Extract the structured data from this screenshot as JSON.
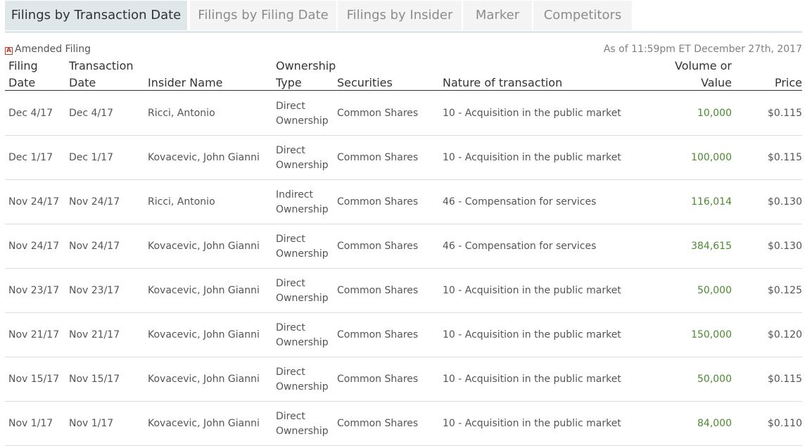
{
  "tabs": [
    {
      "label": "Filings by Transaction Date",
      "active": true
    },
    {
      "label": "Filings by Filing Date",
      "active": false
    },
    {
      "label": "Filings by Insider",
      "active": false
    },
    {
      "label": "Marker",
      "active": false
    },
    {
      "label": "Competitors",
      "active": false
    }
  ],
  "legend": {
    "icon": "amended-filing-icon",
    "icon_glyph": "A",
    "label": "Amended Filing"
  },
  "as_of": "As of 11:59pm ET December 27th, 2017",
  "colors": {
    "volume": "#4b8b2f",
    "active_tab": "#dfe7ea",
    "inactive_tab": "#f4f4f4",
    "amended": "#c0392b"
  },
  "table": {
    "headers": {
      "filing_date": [
        "Filing",
        "Date"
      ],
      "transaction_date": [
        "Transaction",
        "Date"
      ],
      "insider_name": "Insider Name",
      "ownership_type": [
        "Ownership",
        "Type"
      ],
      "securities": "Securities",
      "nature": "Nature of transaction",
      "volume": [
        "Volume or",
        "Value"
      ],
      "price": "Price"
    },
    "rows": [
      {
        "filing_date": "Dec 4/17",
        "transaction_date": "Dec 4/17",
        "insider": "Ricci, Antonio",
        "ownership": [
          "Direct",
          "Ownership"
        ],
        "securities": "Common Shares",
        "nature": "10 - Acquisition in the public market",
        "volume": "10,000",
        "price": "$0.115"
      },
      {
        "filing_date": "Dec 1/17",
        "transaction_date": "Dec 1/17",
        "insider": "Kovacevic, John Gianni",
        "ownership": [
          "Direct",
          "Ownership"
        ],
        "securities": "Common Shares",
        "nature": "10 - Acquisition in the public market",
        "volume": "100,000",
        "price": "$0.115"
      },
      {
        "filing_date": "Nov 24/17",
        "transaction_date": "Nov 24/17",
        "insider": "Ricci, Antonio",
        "ownership": [
          "Indirect",
          "Ownership"
        ],
        "securities": "Common Shares",
        "nature": "46 - Compensation for services",
        "volume": "116,014",
        "price": "$0.130"
      },
      {
        "filing_date": "Nov 24/17",
        "transaction_date": "Nov 24/17",
        "insider": "Kovacevic, John Gianni",
        "ownership": [
          "Direct",
          "Ownership"
        ],
        "securities": "Common Shares",
        "nature": "46 - Compensation for services",
        "volume": "384,615",
        "price": "$0.130"
      },
      {
        "filing_date": "Nov 23/17",
        "transaction_date": "Nov 23/17",
        "insider": "Kovacevic, John Gianni",
        "ownership": [
          "Direct",
          "Ownership"
        ],
        "securities": "Common Shares",
        "nature": "10 - Acquisition in the public market",
        "volume": "50,000",
        "price": "$0.125"
      },
      {
        "filing_date": "Nov 21/17",
        "transaction_date": "Nov 21/17",
        "insider": "Kovacevic, John Gianni",
        "ownership": [
          "Direct",
          "Ownership"
        ],
        "securities": "Common Shares",
        "nature": "10 - Acquisition in the public market",
        "volume": "150,000",
        "price": "$0.120"
      },
      {
        "filing_date": "Nov 15/17",
        "transaction_date": "Nov 15/17",
        "insider": "Kovacevic, John Gianni",
        "ownership": [
          "Direct",
          "Ownership"
        ],
        "securities": "Common Shares",
        "nature": "10 - Acquisition in the public market",
        "volume": "50,000",
        "price": "$0.115"
      },
      {
        "filing_date": "Nov 1/17",
        "transaction_date": "Nov 1/17",
        "insider": "Kovacevic, John Gianni",
        "ownership": [
          "Direct",
          "Ownership"
        ],
        "securities": "Common Shares",
        "nature": "10 - Acquisition in the public market",
        "volume": "84,000",
        "price": "$0.110"
      }
    ]
  }
}
